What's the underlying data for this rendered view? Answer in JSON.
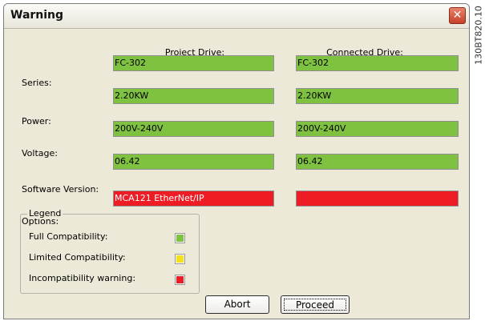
{
  "window": {
    "title": "Warning"
  },
  "columns": {
    "project": "Project Drive:",
    "connected": "Connected Drive:"
  },
  "rows": [
    {
      "label": "Series:",
      "project": "FC-302",
      "connected": "FC-302",
      "project_status": "full",
      "connected_status": "full"
    },
    {
      "label": "Power:",
      "project": "2.20KW",
      "connected": "2.20KW",
      "project_status": "full",
      "connected_status": "full"
    },
    {
      "label": "Voltage:",
      "project": "200V-240V",
      "connected": "200V-240V",
      "project_status": "full",
      "connected_status": "full"
    },
    {
      "label": "Software Version:",
      "project": "06.42",
      "connected": "06.42",
      "project_status": "full",
      "connected_status": "full"
    },
    {
      "label": "Options:",
      "project": "MCA121 EtherNet/IP",
      "connected": "",
      "project_status": "incompatible",
      "connected_status": "incompatible"
    }
  ],
  "legend": {
    "title": "Legend",
    "items": [
      {
        "label": "Full Compatibility:",
        "color": "#7fc242"
      },
      {
        "label": "Limited Compatibility:",
        "color": "#f5e01b"
      },
      {
        "label": "Incompatibility warning:",
        "color": "#ee1c25"
      }
    ]
  },
  "buttons": {
    "abort": "Abort",
    "proceed": "Proceed"
  },
  "side_code": "130BT820.10",
  "icons": {
    "close": "close-icon"
  }
}
